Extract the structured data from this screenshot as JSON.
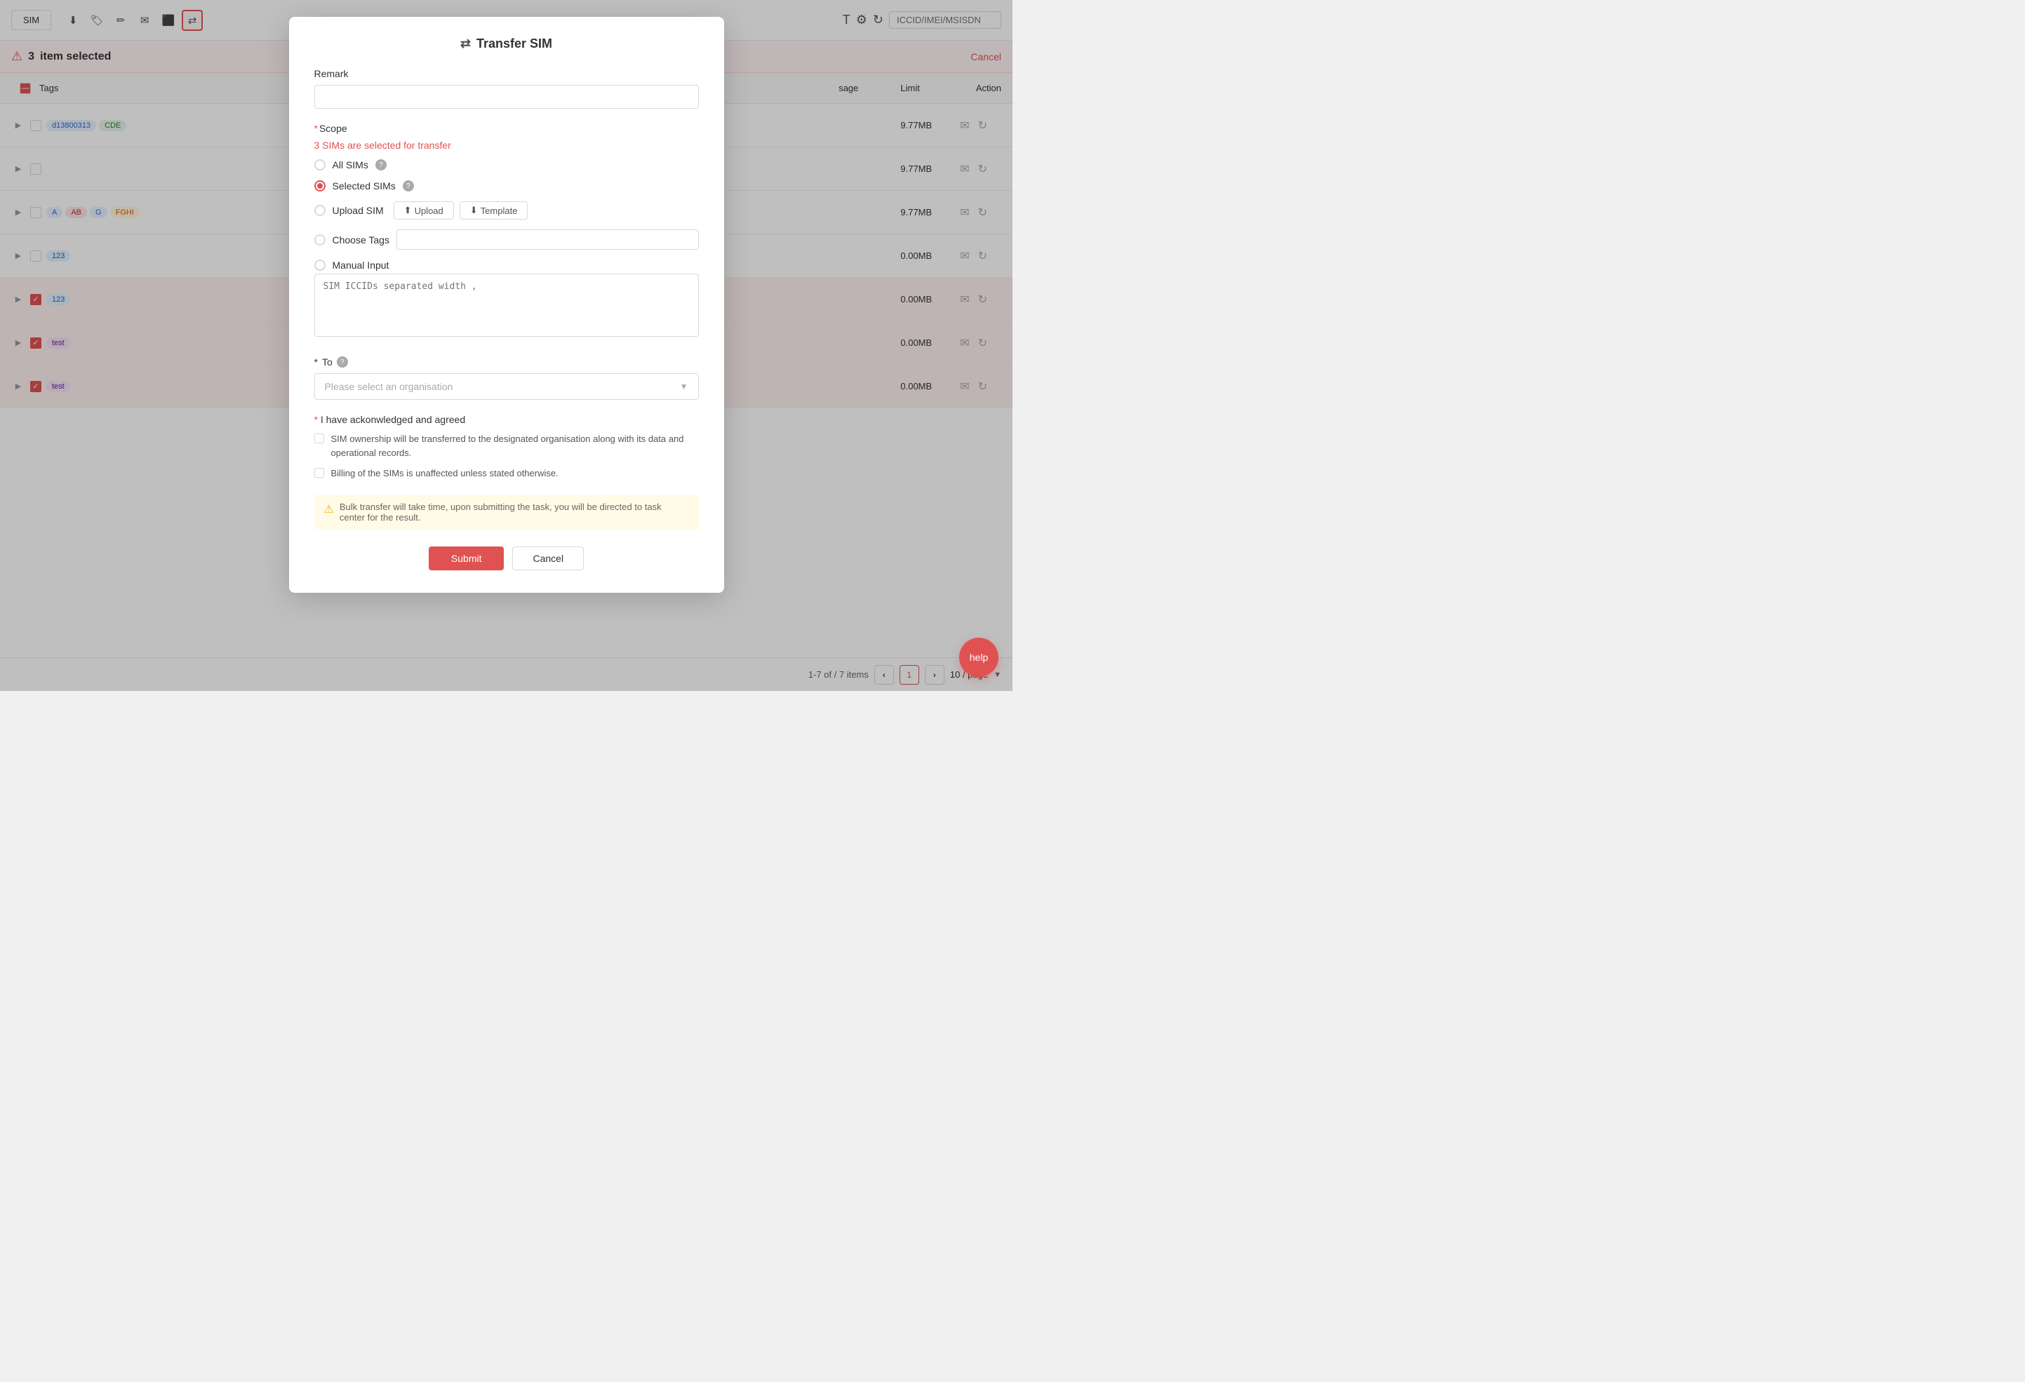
{
  "page": {
    "title": "SIM"
  },
  "toolbar": {
    "download_icon": "⬇",
    "tag_icon": "🏷",
    "edit_icon": "✏",
    "mail_icon": "✉",
    "export_icon": "⬛",
    "transfer_icon": "⇄",
    "search_placeholder": "ICCID/IMEI/MSISDN"
  },
  "selected_bar": {
    "count": "3",
    "label": "item selected",
    "cancel": "Cancel"
  },
  "table": {
    "headers": {
      "tags": "Tags",
      "usage": "sage",
      "limit": "Limit",
      "action": "Action"
    },
    "rows": [
      {
        "id": 1,
        "tags": [
          {
            "label": "d13800313",
            "bg": "#e8f0fe",
            "color": "#3366cc"
          },
          {
            "label": "CDE",
            "bg": "#e6f4ea",
            "color": "#2e7d32"
          }
        ],
        "usage": "9.77MB",
        "selected": false
      },
      {
        "id": 2,
        "tags": [],
        "usage": "9.77MB",
        "selected": false
      },
      {
        "id": 3,
        "tags": [
          {
            "label": "A",
            "bg": "#e8f0fe",
            "color": "#3366cc"
          },
          {
            "label": "AB",
            "bg": "#fce4ec",
            "color": "#c62828"
          },
          {
            "label": "FGHI",
            "bg": "#fff8e1",
            "color": "#e65100"
          }
        ],
        "usage": "9.77MB",
        "selected": false
      },
      {
        "id": 4,
        "tags": [
          {
            "label": "123",
            "bg": "#e3f2fd",
            "color": "#1565c0"
          }
        ],
        "usage": "0.00MB",
        "selected": false
      },
      {
        "id": 5,
        "tags": [
          {
            "label": "123",
            "bg": "#e3f2fd",
            "color": "#1565c0"
          }
        ],
        "usage": "0.00MB",
        "selected": true
      },
      {
        "id": 6,
        "tags": [
          {
            "label": "test",
            "bg": "#f3e5f5",
            "color": "#6a1b9a"
          }
        ],
        "usage": "0.00MB",
        "selected": true
      },
      {
        "id": 7,
        "tags": [
          {
            "label": "test",
            "bg": "#f3e5f5",
            "color": "#6a1b9a"
          }
        ],
        "usage": "0.00MB",
        "selected": true
      }
    ]
  },
  "pagination": {
    "info": "1-7 of / 7 items",
    "current_page": "1",
    "page_size": "10 / page"
  },
  "modal": {
    "title": "Transfer SIM",
    "title_icon": "⇄",
    "remark_label": "Remark",
    "remark_placeholder": "",
    "scope_label": "Scope",
    "scope_info": "3 SIMs are selected for transfer",
    "scope_options": [
      {
        "id": "all",
        "label": "All SIMs",
        "checked": false
      },
      {
        "id": "selected",
        "label": "Selected SIMs",
        "checked": true
      },
      {
        "id": "upload",
        "label": "Upload SIM",
        "checked": false
      },
      {
        "id": "tags",
        "label": "Choose Tags",
        "checked": false
      },
      {
        "id": "manual",
        "label": "Manual Input",
        "checked": false
      }
    ],
    "upload_btn": "Upload",
    "template_btn": "Template",
    "manual_placeholder": "SIM ICCIDs separated width ,",
    "to_label": "To",
    "to_placeholder": "Please select an organisation",
    "agree_title": "I have ackonwledged and agreed",
    "agree_items": [
      "SIM ownership will be transferred to the designated organisation along with its data and operational records.",
      "Billing of the SIMs is unaffected unless stated otherwise."
    ],
    "bulk_notice": "Bulk transfer will take time, upon submitting the task, you will be directed to task center for the result.",
    "submit_label": "Submit",
    "cancel_label": "Cancel"
  },
  "help_label": "help"
}
